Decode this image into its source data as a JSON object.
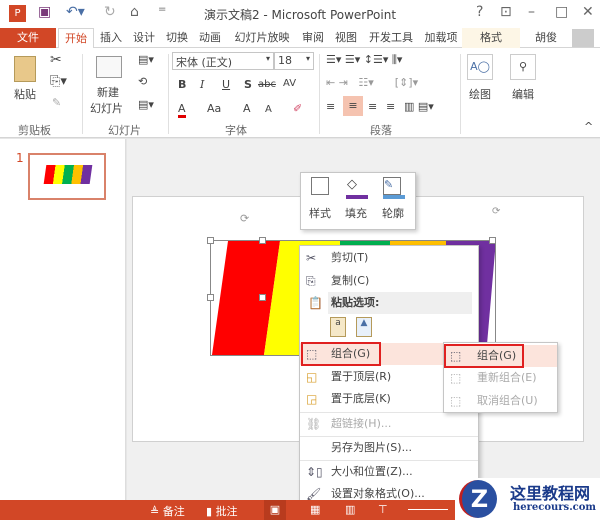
{
  "window": {
    "title": "演示文稿2 - Microsoft PowerPoint",
    "help": "?",
    "controls": [
      "–",
      "□",
      "✕"
    ]
  },
  "tabs": [
    "文件",
    "开始",
    "插入",
    "设计",
    "切换",
    "动画",
    "幻灯片放映",
    "审阅",
    "视图",
    "开发工具",
    "加载项",
    "格式"
  ],
  "user": "胡俊",
  "ribbon": {
    "paste": "粘贴",
    "new_slide_1": "新建",
    "new_slide_2": "幻灯片",
    "font_name": "宋体 (正文)",
    "font_size": "18",
    "bold": "B",
    "italic": "I",
    "underline": "U",
    "shadow": "S",
    "strike": "abc",
    "spacing": "AV",
    "font_color": "A",
    "case": "Aa",
    "grow": "A",
    "shrink": "A",
    "draw": "绘图",
    "edit": "编辑",
    "groups": [
      "剪贴板",
      "幻灯片",
      "字体",
      "段落"
    ]
  },
  "slide_panel": {
    "number": "1"
  },
  "mini_toolbar": {
    "style": "样式",
    "fill": "填充",
    "outline": "轮廓",
    "fill_color": "#7030a0",
    "outline_color": "#5b9bd5"
  },
  "shapes": {
    "colors": [
      "#ff0000",
      "#ffff00",
      "#00b050",
      "#ffc000",
      "#7030a0"
    ]
  },
  "context_menu": {
    "cut": "剪切(T)",
    "copy": "复制(C)",
    "paste_options": "粘贴选项:",
    "group": "组合(G)",
    "bring_front": "置于顶层(R)",
    "send_back": "置于底层(K)",
    "hyperlink": "超链接(H)...",
    "save_picture": "另存为图片(S)...",
    "size_position": "大小和位置(Z)...",
    "format_object": "设置对象格式(O)..."
  },
  "submenu": {
    "group": "组合(G)",
    "regroup": "重新组合(E)",
    "ungroup": "取消组合(U)"
  },
  "status": {
    "notes": "备注",
    "comments": "批注"
  },
  "watermark": {
    "title": "这里教程网",
    "url": "herecours.com"
  }
}
